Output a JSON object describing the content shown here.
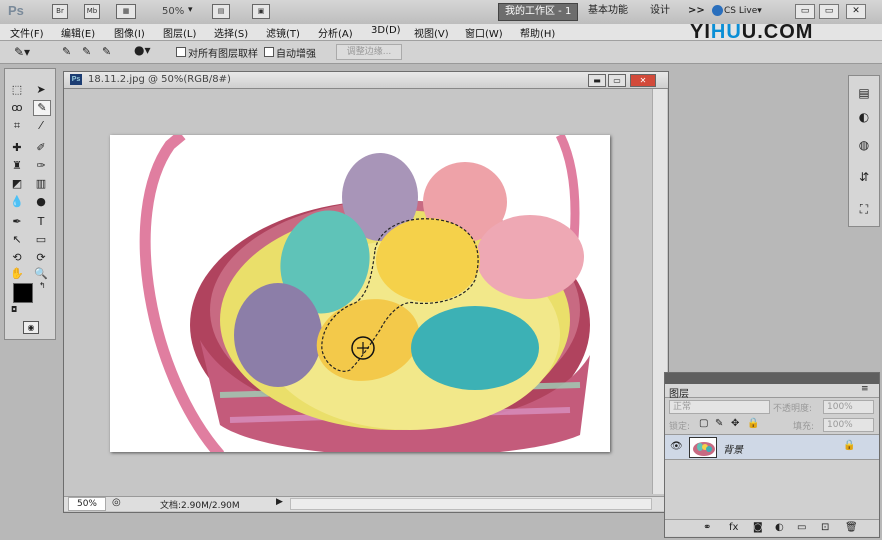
{
  "app_logo": "Ps",
  "topbar": {
    "zoom": "50%",
    "workspaces": [
      "我的工作区 - 1",
      "基本功能",
      "设计"
    ],
    "more": ">>",
    "cs_live": "CS Live▾",
    "win_buttons": [
      "▭",
      "▭",
      "✕"
    ]
  },
  "menu": [
    "文件(F)",
    "编辑(E)",
    "图像(I)",
    "图层(L)",
    "选择(S)",
    "滤镜(T)",
    "分析(A)",
    "3D(D)",
    "视图(V)",
    "窗口(W)",
    "帮助(H)"
  ],
  "watermark": {
    "a": "YI",
    "b": "HU",
    "c": "U",
    "d": ".COM"
  },
  "options": {
    "sample_all_layers": "对所有图层取样",
    "auto_enhance": "自动增强",
    "refine_edge": "调整边缘..."
  },
  "document": {
    "title": "18.11.2.jpg @ 50%(RGB/8#)",
    "ps_badge": "Ps",
    "zoom": "50%",
    "doc_size": "文档:2.90M/2.90M"
  },
  "layers_panel": {
    "tab": "图层",
    "blend_mode": "正常",
    "opacity_label": "不透明度:",
    "opacity_value": "100%",
    "lock_label": "锁定:",
    "fill_label": "填充:",
    "fill_value": "100%",
    "layer_name": "背景"
  },
  "colors": {
    "foreground": "#000000",
    "background": "#ffffff",
    "accent": "#0b8fd6"
  }
}
